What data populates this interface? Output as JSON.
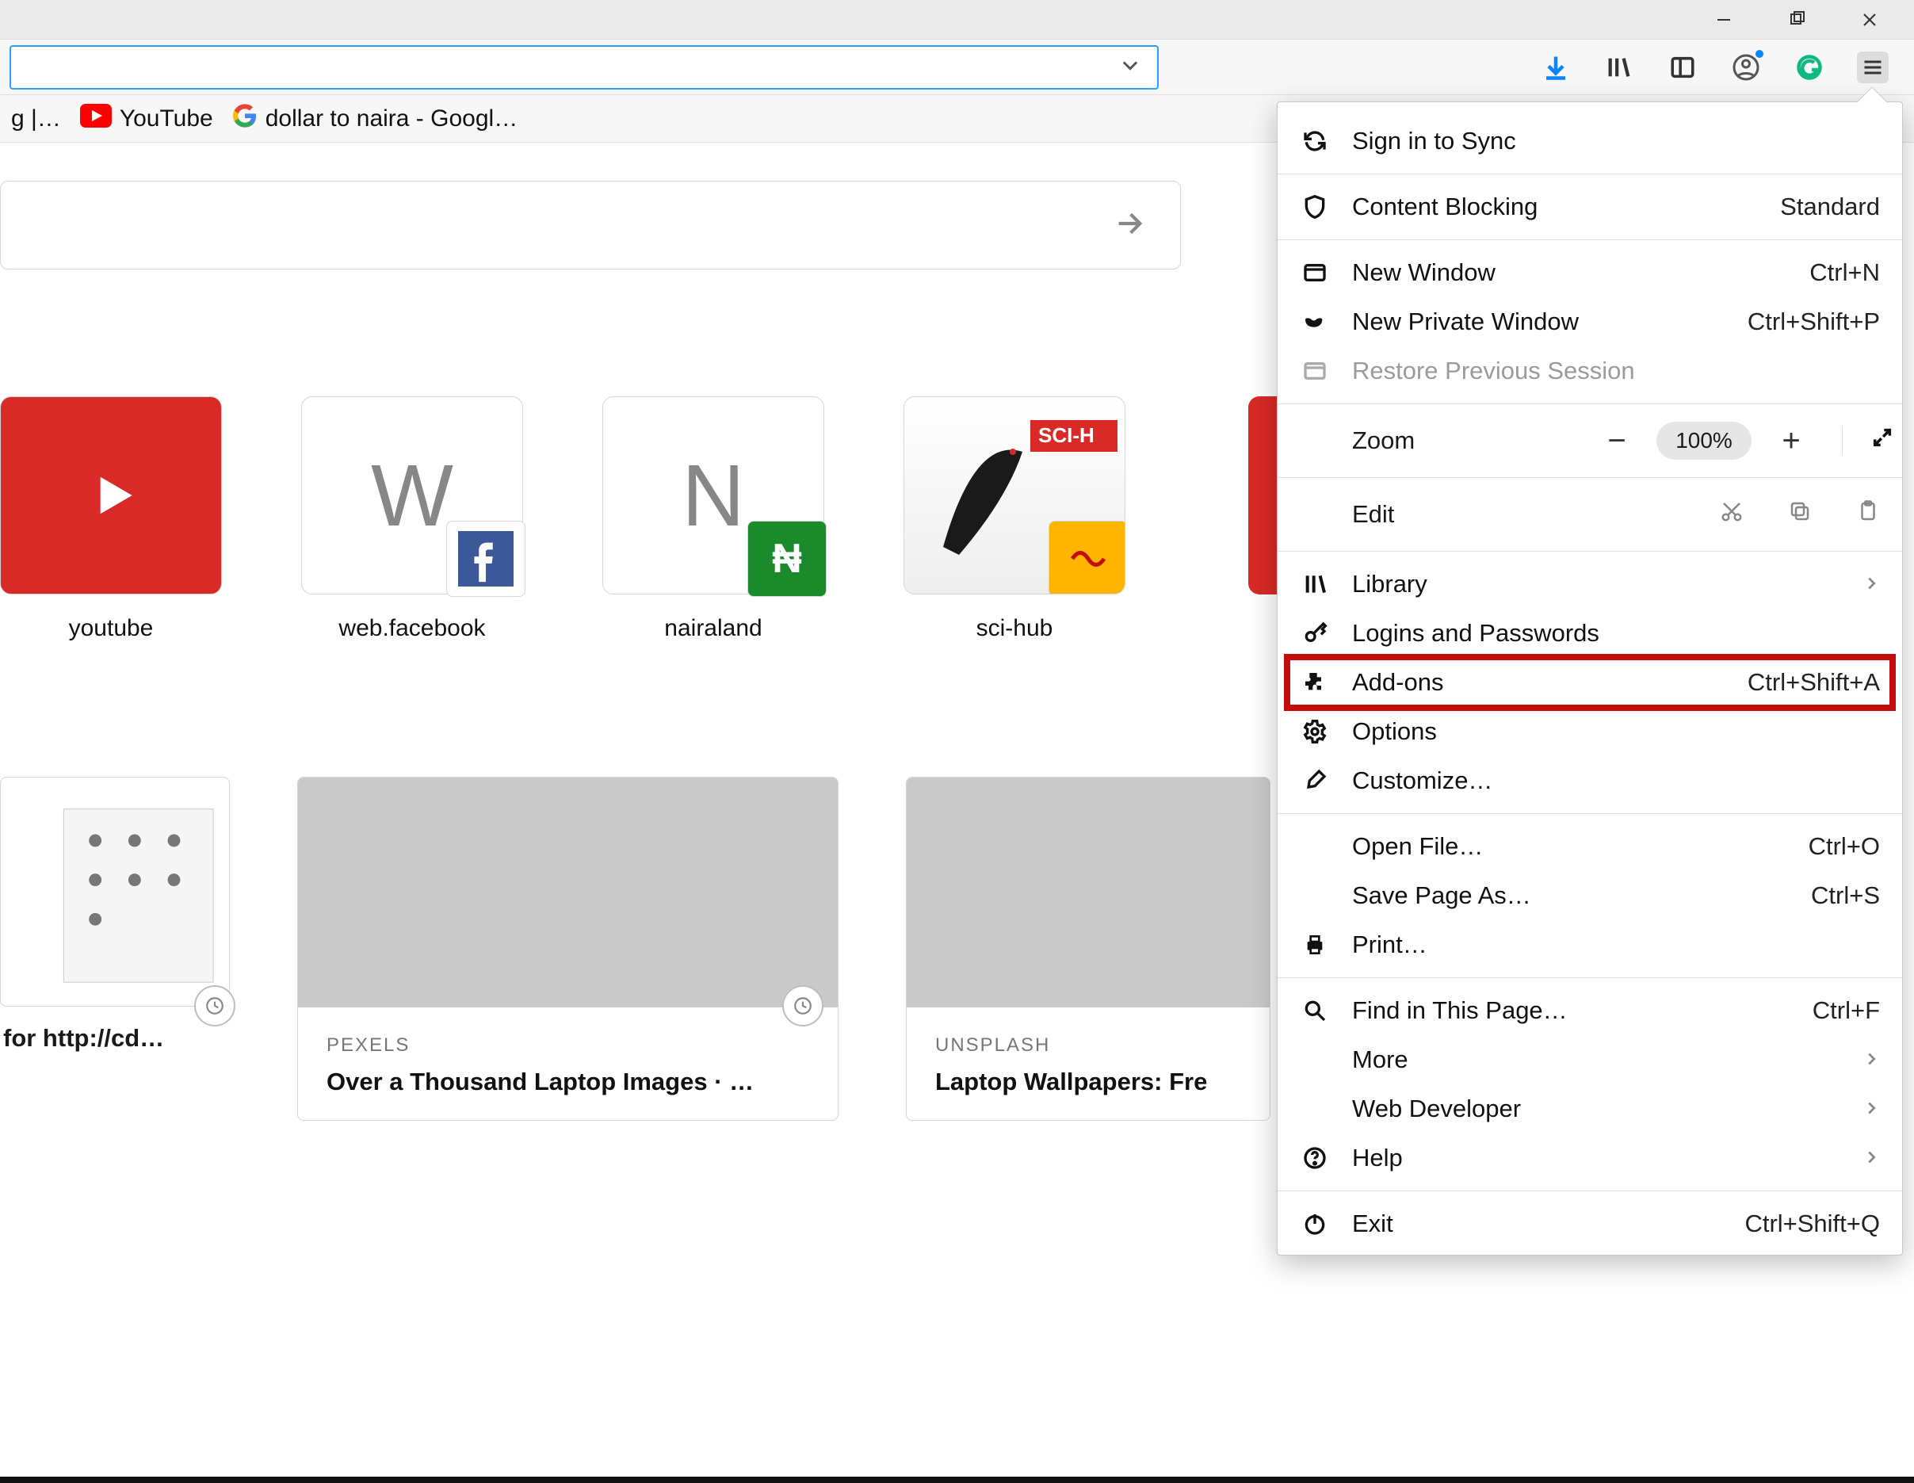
{
  "window_controls": {
    "min": "minimize",
    "max": "maximize",
    "close": "close"
  },
  "toolbar": {
    "downloads_color": "#0a84ff",
    "grammarly_color": "#10b981"
  },
  "bookmarks": {
    "first_truncated": "g |…",
    "youtube": "YouTube",
    "google": "dollar to naira - Googl…"
  },
  "search": {
    "placeholder": ""
  },
  "tiles": [
    {
      "label": "youtube"
    },
    {
      "label": "web.facebook",
      "letter": "W",
      "badge": "facebook"
    },
    {
      "label": "nairaland",
      "letter": "N",
      "badge": "naira"
    },
    {
      "label": "sci-hub",
      "image": true
    }
  ],
  "cards": [
    {
      "title": "for http://cd…"
    },
    {
      "source": "PEXELS",
      "title": "Over a Thousand Laptop Images · …"
    },
    {
      "source": "UNSPLASH",
      "title": "Laptop Wallpapers: Fre"
    }
  ],
  "menu": {
    "sync": "Sign in to Sync",
    "content_blocking": {
      "label": "Content Blocking",
      "right": "Standard"
    },
    "new_window": {
      "label": "New Window",
      "shortcut": "Ctrl+N"
    },
    "new_private": {
      "label": "New Private Window",
      "shortcut": "Ctrl+Shift+P"
    },
    "restore": {
      "label": "Restore Previous Session"
    },
    "zoom": {
      "label": "Zoom",
      "value": "100%"
    },
    "edit": {
      "label": "Edit"
    },
    "library": {
      "label": "Library"
    },
    "logins": {
      "label": "Logins and Passwords"
    },
    "addons": {
      "label": "Add-ons",
      "shortcut": "Ctrl+Shift+A"
    },
    "options": {
      "label": "Options"
    },
    "customize": {
      "label": "Customize…"
    },
    "open_file": {
      "label": "Open File…",
      "shortcut": "Ctrl+O"
    },
    "save_as": {
      "label": "Save Page As…",
      "shortcut": "Ctrl+S"
    },
    "print": {
      "label": "Print…"
    },
    "find": {
      "label": "Find in This Page…",
      "shortcut": "Ctrl+F"
    },
    "more": {
      "label": "More"
    },
    "webdev": {
      "label": "Web Developer"
    },
    "help": {
      "label": "Help"
    },
    "exit": {
      "label": "Exit",
      "shortcut": "Ctrl+Shift+Q"
    }
  }
}
